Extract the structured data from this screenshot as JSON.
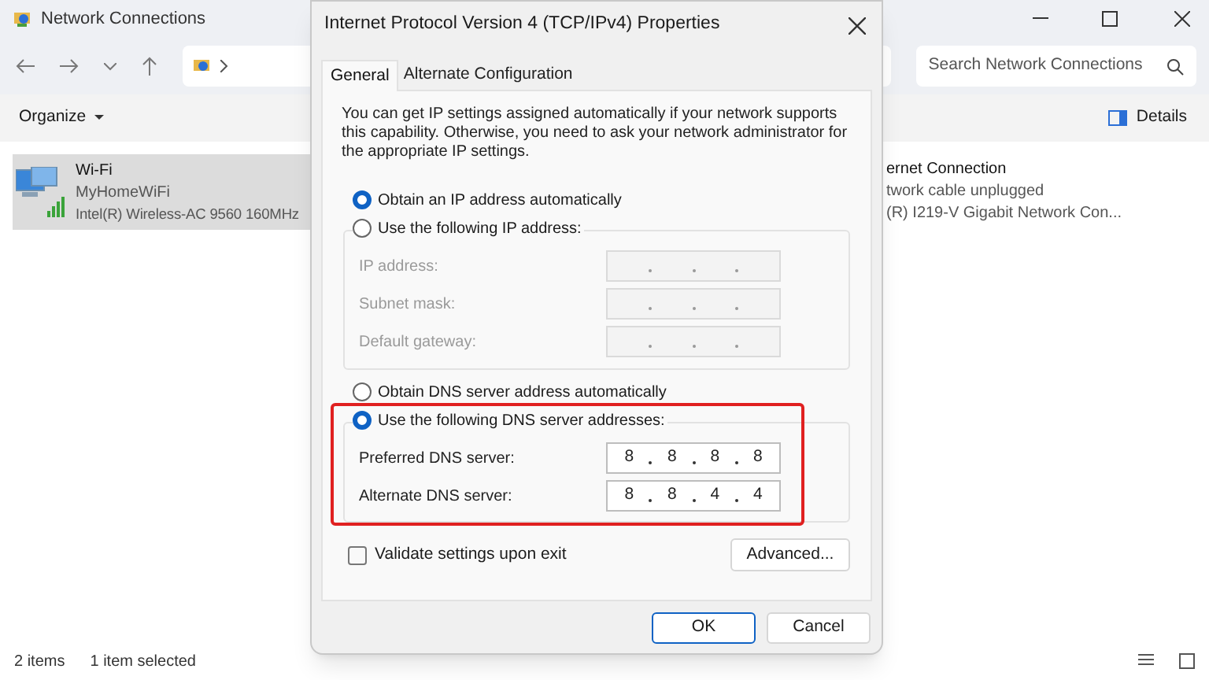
{
  "explorer": {
    "title": "Network Connections",
    "search": {
      "placeholder": "Search Network Connections"
    },
    "toolbar": {
      "organize": "Organize",
      "details": "Details"
    },
    "items": [
      {
        "name": "Wi-Fi",
        "network": "MyHomeWiFi",
        "adapter": "Intel(R) Wireless-AC 9560 160MHz",
        "selected": true
      }
    ],
    "partial_item": {
      "name": "ernet Connection",
      "status": "twork cable unplugged",
      "adapter": "(R) I219-V Gigabit Network Con..."
    },
    "status_bar": {
      "count": "2 items",
      "selection": "1 item selected"
    }
  },
  "dialog": {
    "title": "Internet Protocol Version 4 (TCP/IPv4) Properties",
    "tabs": [
      {
        "label": "General",
        "selected": true
      },
      {
        "label": "Alternate Configuration",
        "selected": false
      }
    ],
    "description": "You can get IP settings assigned automatically if your network supports this capability. Otherwise, you need to ask your network administrator for the appropriate IP settings.",
    "ip_options": [
      {
        "label": "Obtain an IP address automatically",
        "selected": true
      },
      {
        "label": "Use the following IP address:",
        "selected": false
      }
    ],
    "ip_fields": [
      {
        "label": "IP address:",
        "disabled": true
      },
      {
        "label": "Subnet mask:",
        "disabled": true
      },
      {
        "label": "Default gateway:",
        "disabled": true
      }
    ],
    "dns_options": [
      {
        "label": "Obtain DNS server address automatically",
        "selected": false
      },
      {
        "label": "Use the following DNS server addresses:",
        "selected": true
      }
    ],
    "dns_fields": [
      {
        "label": "Preferred DNS server:",
        "disabled": false,
        "octets": [
          "8",
          "8",
          "8",
          "8"
        ]
      },
      {
        "label": "Alternate DNS server:",
        "disabled": false,
        "octets": [
          "8",
          "8",
          "4",
          "4"
        ]
      }
    ],
    "validate": {
      "label": "Validate settings upon exit",
      "checked": false
    },
    "advanced": "Advanced...",
    "ok": "OK",
    "cancel": "Cancel"
  }
}
